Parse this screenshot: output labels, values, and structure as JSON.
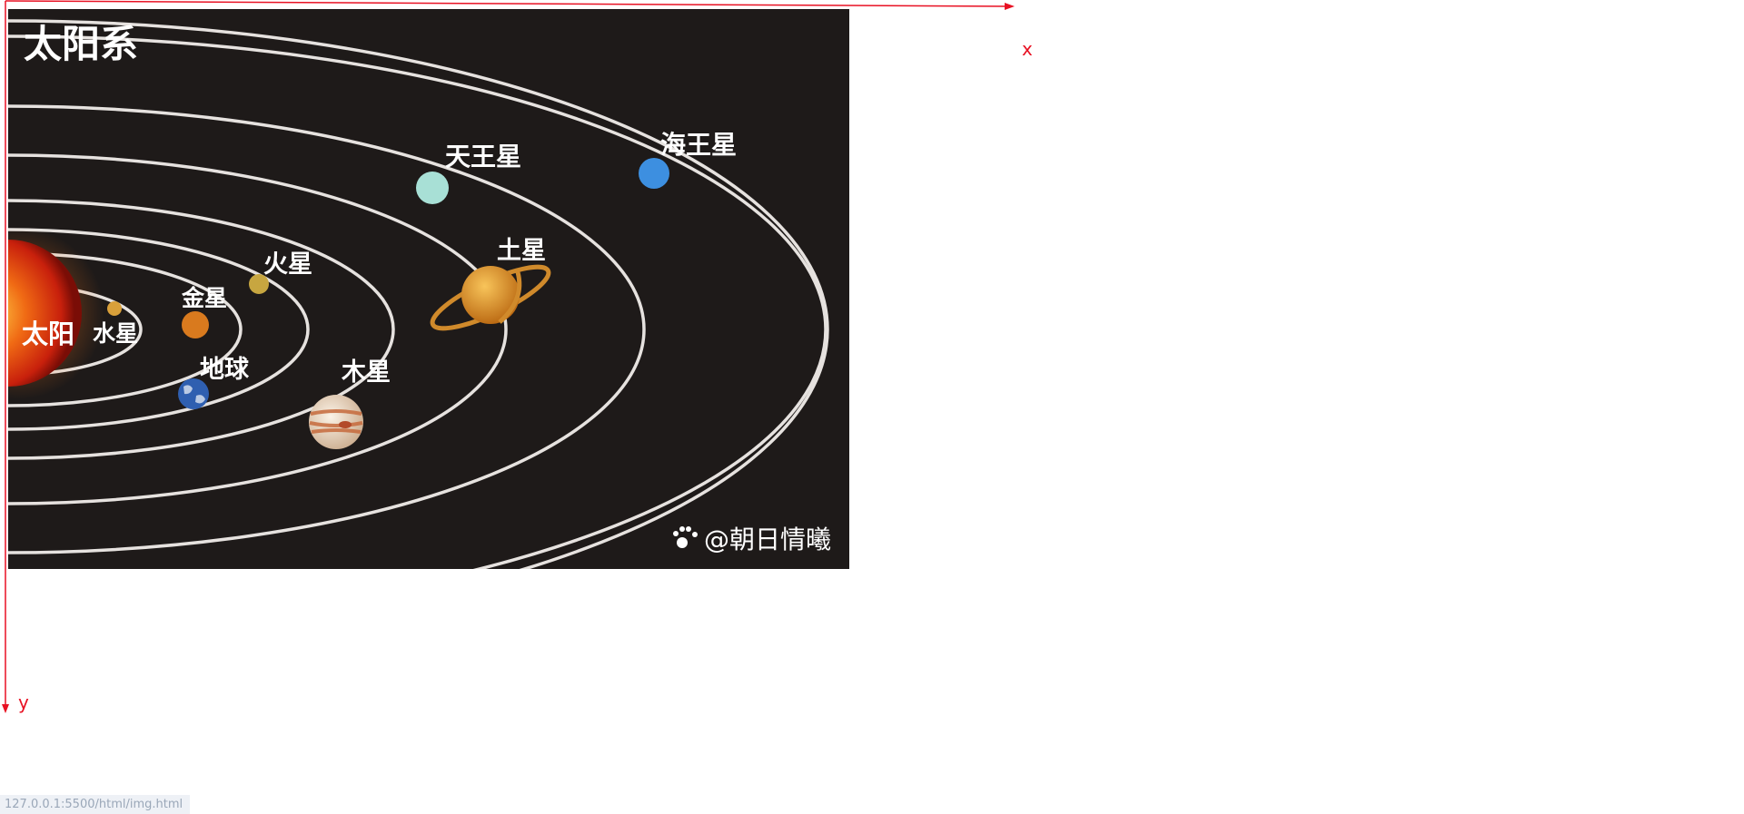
{
  "axes": {
    "x_label": "x",
    "y_label": "y"
  },
  "image": {
    "title": "太阳系",
    "sun_label": "太阳",
    "planets": [
      {
        "key": "mercury",
        "label": "水星",
        "color": "#d9a03a"
      },
      {
        "key": "venus",
        "label": "金星",
        "color": "#d97a1e"
      },
      {
        "key": "earth",
        "label": "地球",
        "color": "#2f5fb0"
      },
      {
        "key": "mars",
        "label": "火星",
        "color": "#c7a640"
      },
      {
        "key": "jupiter",
        "label": "木星",
        "color": "#e8d3b8"
      },
      {
        "key": "saturn",
        "label": "土星",
        "color": "#e2a033"
      },
      {
        "key": "uranus",
        "label": "天王星",
        "color": "#a8e0d6"
      },
      {
        "key": "neptune",
        "label": "海王星",
        "color": "#3d8fe0"
      }
    ],
    "watermark": "@朝日情曦"
  },
  "status_bar": {
    "url": "127.0.0.1:5500/html/img.html"
  },
  "colors": {
    "axis": "#e81123",
    "space": "#1e1a19",
    "orbit": "#e6e2df"
  }
}
